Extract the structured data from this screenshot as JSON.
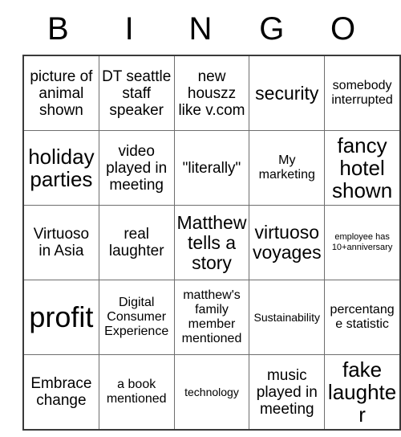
{
  "header": {
    "letters": [
      "B",
      "I",
      "N",
      "G",
      "O"
    ]
  },
  "grid": {
    "rows": [
      [
        {
          "text": "picture of animal shown",
          "size": "fs-md"
        },
        {
          "text": "DT seattle staff speaker",
          "size": "fs-md"
        },
        {
          "text": "new houszz like v.com",
          "size": "fs-md"
        },
        {
          "text": "security",
          "size": "fs-lg"
        },
        {
          "text": "somebody interrupted",
          "size": "fs-sm"
        }
      ],
      [
        {
          "text": "holiday parties",
          "size": "fs-xl"
        },
        {
          "text": "video played in meeting",
          "size": "fs-md"
        },
        {
          "text": "\"literally\"",
          "size": "fs-md"
        },
        {
          "text": "My marketing",
          "size": "fs-sm"
        },
        {
          "text": "fancy hotel shown",
          "size": "fs-xl"
        }
      ],
      [
        {
          "text": "Virtuoso in Asia",
          "size": "fs-md"
        },
        {
          "text": "real laughter",
          "size": "fs-md"
        },
        {
          "text": "Matthew tells a story",
          "size": "fs-lg"
        },
        {
          "text": "virtuoso voyages",
          "size": "fs-lg"
        },
        {
          "text": "employee has 10+anniversary",
          "size": "fs-xxs"
        }
      ],
      [
        {
          "text": "profit",
          "size": "fs-xxl"
        },
        {
          "text": "Digital Consumer Experience",
          "size": "fs-sm"
        },
        {
          "text": "matthew's family member mentioned",
          "size": "fs-sm"
        },
        {
          "text": "Sustainability",
          "size": "fs-xs"
        },
        {
          "text": "percentange statistic",
          "size": "fs-sm"
        }
      ],
      [
        {
          "text": "Embrace change",
          "size": "fs-md"
        },
        {
          "text": "a book mentioned",
          "size": "fs-sm"
        },
        {
          "text": "technology",
          "size": "fs-xs"
        },
        {
          "text": "music played in meeting",
          "size": "fs-md"
        },
        {
          "text": "fake laughter",
          "size": "fs-xl"
        }
      ]
    ]
  },
  "colors": {
    "background": "#ffffff",
    "text": "#000000",
    "grid_line": "#6e6e6e",
    "outer_border": "#3a3a3a"
  }
}
